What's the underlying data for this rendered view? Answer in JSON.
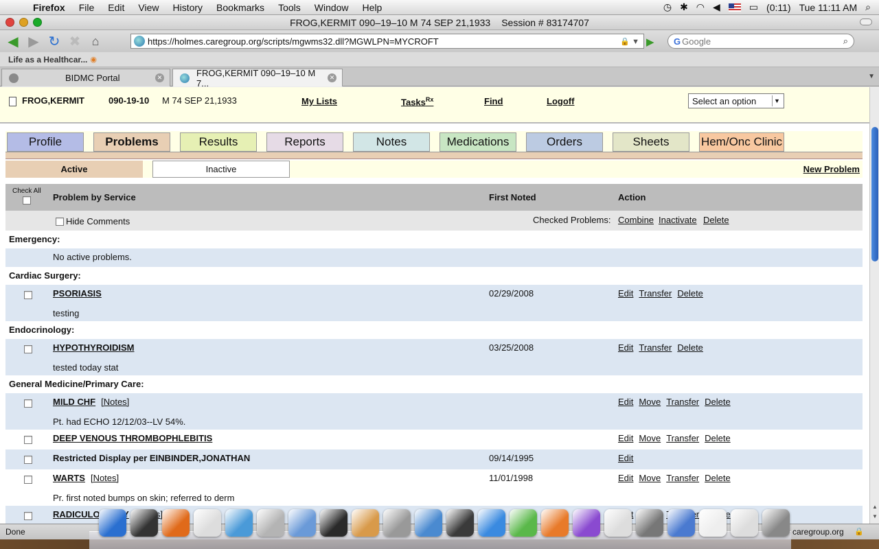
{
  "menubar": {
    "app": "Firefox",
    "items": [
      "File",
      "Edit",
      "View",
      "History",
      "Bookmarks",
      "Tools",
      "Window",
      "Help"
    ],
    "battery": "(0:11)",
    "clock": "Tue 11:11 AM"
  },
  "window": {
    "title": "FROG,KERMIT 090–19–10 M 74 SEP 21,1933",
    "session": "Session # 83174707"
  },
  "browser": {
    "url": "https://holmes.caregroup.org/scripts/mgwms32.dll?MGWLPN=MYCROFT",
    "search_placeholder": "Google",
    "bookmark": "Life as a Healthcar...",
    "tabs": [
      {
        "label": "BIDMC Portal"
      },
      {
        "label": "FROG,KERMIT 090–19–10 M 7..."
      }
    ],
    "status": "Done",
    "status_host": "caregroup.org"
  },
  "patient": {
    "name": "FROG,KERMIT",
    "mrn": "090-19-10",
    "demographics": "M 74  SEP 21,1933",
    "links": {
      "my_lists": "My Lists",
      "tasks": "Tasks",
      "tasks_sup": "Rx",
      "find": "Find",
      "logoff": "Logoff"
    },
    "select_option": "Select an option"
  },
  "app_tabs": [
    {
      "label": "Profile",
      "color": "#b4bce6",
      "active": false
    },
    {
      "label": "Problems",
      "color": "#e8cfb4",
      "active": true
    },
    {
      "label": "Results",
      "color": "#e6f0b4",
      "active": false
    },
    {
      "label": "Reports",
      "color": "#e6dbe6",
      "active": false
    },
    {
      "label": "Notes",
      "color": "#d2e6e6",
      "active": false
    },
    {
      "label": "Medications",
      "color": "#c8e6c3",
      "active": false
    },
    {
      "label": "Orders",
      "color": "#bccbe2",
      "active": false
    },
    {
      "label": "Sheets",
      "color": "#e3e6c8",
      "active": false
    },
    {
      "label": "Hem/Onc Clinic",
      "color": "#f8c8a0",
      "active": false
    }
  ],
  "subtabs": {
    "active": "Active",
    "inactive": "Inactive",
    "new_problem": "New Problem"
  },
  "list": {
    "check_all": "Check All",
    "col_problem": "Problem by Service",
    "col_first_noted": "First Noted",
    "col_action": "Action",
    "hide_comments": "Hide Comments",
    "checked_problems": "Checked Problems:",
    "bulk_actions": {
      "combine": "Combine",
      "inactivate": "Inactivate",
      "delete": "Delete"
    }
  },
  "groups": [
    {
      "name": "Emergency:",
      "note": "No active problems."
    },
    {
      "name": "Cardiac Surgery:"
    },
    {
      "name": "Endocrinology:"
    },
    {
      "name": "General Medicine/Primary Care:"
    }
  ],
  "problems": [
    {
      "name": "PSORIASIS",
      "date": "02/29/2008",
      "comment": "testing",
      "actions": [
        "Edit",
        "Transfer",
        "Delete"
      ]
    },
    {
      "name": "HYPOTHYROIDISM",
      "date": "03/25/2008",
      "comment": "tested today stat",
      "actions": [
        "Edit",
        "Transfer",
        "Delete"
      ]
    },
    {
      "name": "MILD CHF",
      "notes": "[Notes]",
      "date": "",
      "comment": "Pt. had ECHO 12/12/03--LV 54%.",
      "actions": [
        "Edit",
        "Move",
        "Transfer",
        "Delete"
      ]
    },
    {
      "name": "DEEP VENOUS THROMBOPHLEBITIS",
      "date": "",
      "actions": [
        "Edit",
        "Move",
        "Transfer",
        "Delete"
      ]
    },
    {
      "name": "Restricted Display per EINBINDER,JONATHAN",
      "date": "09/14/1995",
      "actions": [
        "Edit"
      ]
    },
    {
      "name": "WARTS",
      "notes": "[Notes]",
      "date": "11/01/1998",
      "comment": "Pr. first noted bumps on skin; referred to derm",
      "actions": [
        "Edit",
        "Move",
        "Transfer",
        "Delete"
      ]
    },
    {
      "name": "RADICULOPATHY",
      "notes": "[Notes]",
      "date": "",
      "actions": [
        "Edit",
        "Move",
        "Transfer",
        "Delete"
      ]
    }
  ]
}
